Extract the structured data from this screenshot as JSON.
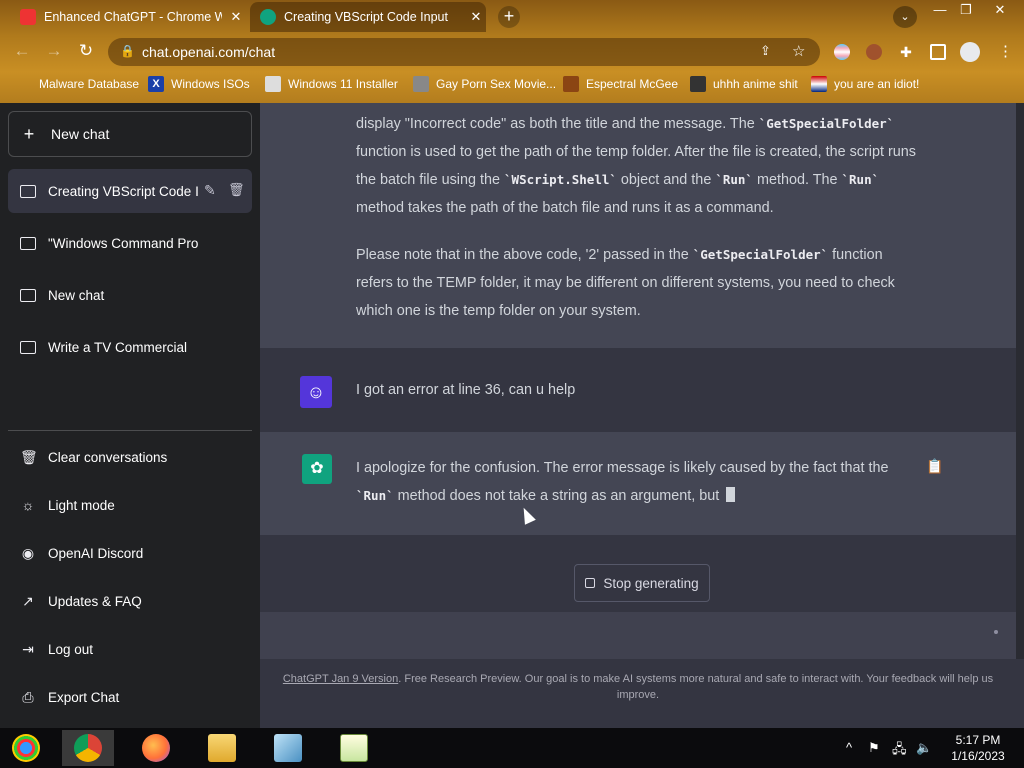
{
  "browser": {
    "tabs": [
      {
        "title": "Enhanced ChatGPT - Chrome Web",
        "close": "✕",
        "active": false
      },
      {
        "title": "Creating VBScript Code Input",
        "close": "✕",
        "active": true
      }
    ],
    "new_tab": "+",
    "tab_search": "⌄",
    "window_controls": {
      "minimize": "—",
      "restore": "❐",
      "close": "✕"
    },
    "nav": {
      "back": "←",
      "forward": "→",
      "reload": "↻"
    },
    "url": "chat.openai.com/chat",
    "bookmarks": [
      {
        "label": "Malware Database",
        "icon": "bug-icon"
      },
      {
        "label": "Windows ISOs",
        "icon": "x-logo-icon"
      },
      {
        "label": "Windows 11 Installer",
        "icon": "image-icon"
      },
      {
        "label": "Gay Porn Sex Movie...",
        "icon": "skull-icon"
      },
      {
        "label": "Espectral McGee",
        "icon": "face-icon"
      },
      {
        "label": "uhhh anime shit",
        "icon": "anime-icon"
      },
      {
        "label": "you are an idiot!",
        "icon": "flag-icon"
      }
    ]
  },
  "sidebar": {
    "new_chat": "New chat",
    "conversations": [
      {
        "label": "Creating VBScript Code In",
        "active": true
      },
      {
        "label": "\"Windows Command Prompt C D",
        "active": false
      },
      {
        "label": "New chat",
        "active": false
      },
      {
        "label": "Write a TV Commercial",
        "active": false
      }
    ],
    "menu": [
      {
        "label": "Clear conversations",
        "icon": "trash-icon"
      },
      {
        "label": "Light mode",
        "icon": "sun-icon"
      },
      {
        "label": "OpenAI Discord",
        "icon": "discord-icon"
      },
      {
        "label": "Updates & FAQ",
        "icon": "external-link-icon"
      },
      {
        "label": "Log out",
        "icon": "logout-icon"
      },
      {
        "label": "Export Chat",
        "icon": "export-icon"
      }
    ]
  },
  "chat": {
    "prev_response": {
      "p1_a": "display \"Incorrect code\" as both the title and the message. The ",
      "p1_code1": "`GetSpecialFolder`",
      "p1_b": " function is used to get the path of the temp folder. After the file is created, the script runs the batch file using the ",
      "p1_code2": "`WScript.Shell`",
      "p1_c": " object and the ",
      "p1_code3": "`Run`",
      "p1_d": " method. The ",
      "p1_code4": "`Run`",
      "p1_e": " method takes the path of the batch file and runs it as a command.",
      "p2_a": "Please note that in the above code, '2' passed in the ",
      "p2_code": "`GetSpecialFolder`",
      "p2_b": " function refers to the TEMP folder, it may be different on different systems, you need to check which one is the temp folder on your system."
    },
    "user_message": "I got an error at line 36, can u help",
    "ai_response": {
      "a": "I apologize for the confusion. The error message is likely caused by the fact that the ",
      "code": "`Run`",
      "b": " method does not take a string as an argument, but "
    },
    "stop_button": "Stop generating",
    "footer_link": "ChatGPT Jan 9 Version",
    "footer_text": ". Free Research Preview. Our goal is to make AI systems more natural and safe to interact with. Your feedback will help us improve."
  },
  "taskbar": {
    "time": "5:17 PM",
    "date": "1/16/2023",
    "tray_arrow": "^"
  }
}
